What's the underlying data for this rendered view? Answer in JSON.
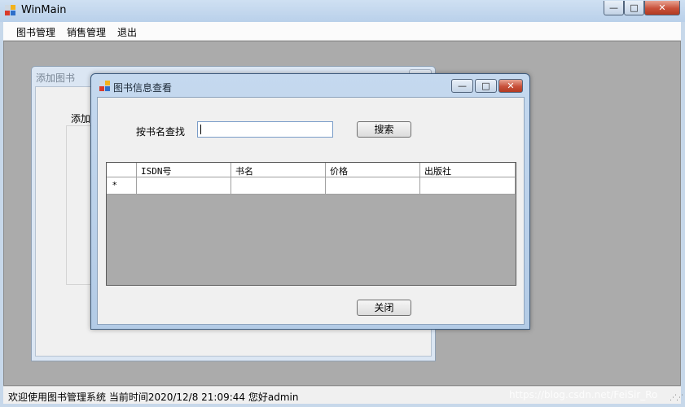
{
  "main_window": {
    "title": "WinMain",
    "buttons": {
      "minimize": "—",
      "maximize": "□",
      "close": "✕"
    }
  },
  "menu": {
    "items": [
      "图书管理",
      "销售管理",
      "退出"
    ]
  },
  "background_window": {
    "title": "添加图书",
    "partial_label": "添加I"
  },
  "dialog": {
    "title": "图书信息查看",
    "buttons": {
      "minimize": "—",
      "maximize": "□",
      "close": "✕"
    },
    "search_label": "按书名查找",
    "search_value": "",
    "search_button": "搜索",
    "grid": {
      "columns": [
        "ISDN号",
        "书名",
        "价格",
        "出版社"
      ],
      "new_row_marker": "*",
      "rows": []
    },
    "close_button": "关闭"
  },
  "status": {
    "text": "欢迎使用图书管理系统  当前时间2020/12/8 21:09:44  您好admin",
    "watermark": "https://blog.csdn.net/FeiSir_Ro"
  },
  "colors": {
    "mdi_background": "#ababab",
    "title_bar": "#c7d8ea",
    "close_button": "#c8513a"
  },
  "icons": [
    "app-icon",
    "minimize-icon",
    "maximize-icon",
    "close-icon",
    "size-grip-icon"
  ]
}
